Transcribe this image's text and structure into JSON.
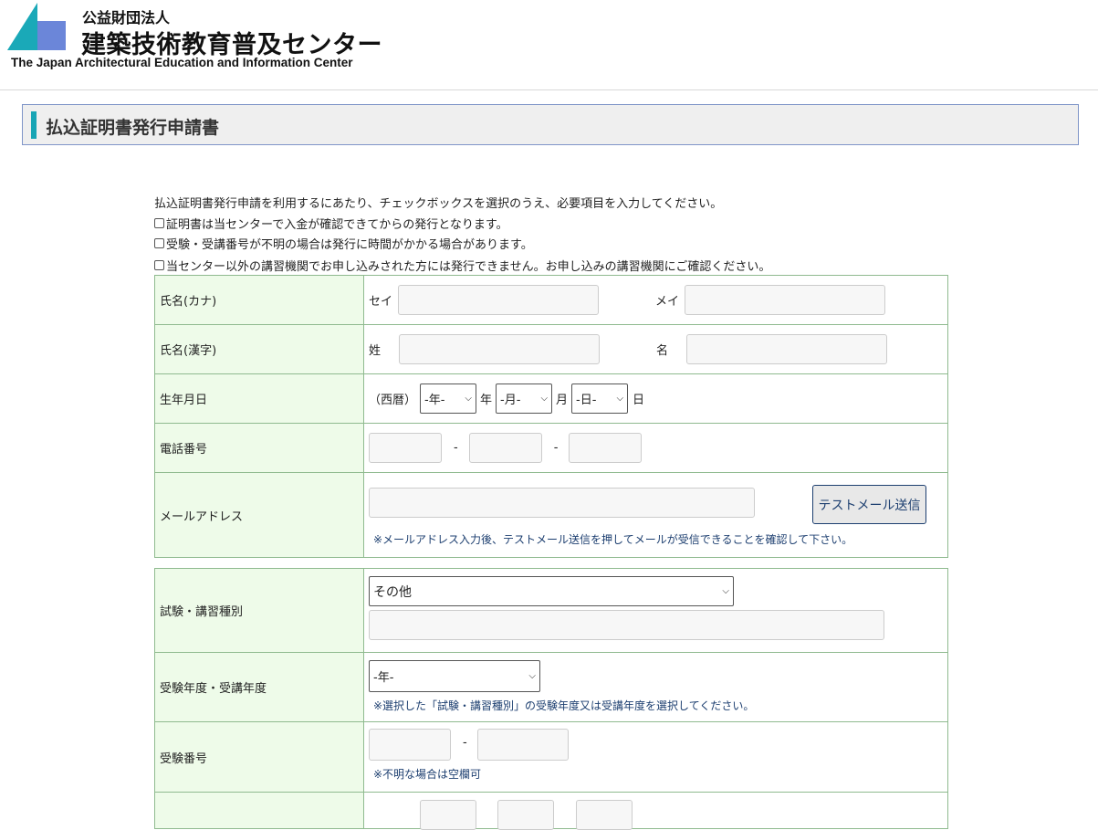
{
  "header": {
    "org_type": "公益財団法人",
    "org_name": "建築技術教育普及センター",
    "org_name_en": "The Japan Architectural Education and Information Center",
    "logo_colors": {
      "teal": "#1aa9b8",
      "blue": "#6b86d9"
    }
  },
  "page_title": "払込証明書発行申請書",
  "notices": {
    "intro": "払込証明書発行申請を利用するにあたり、チェックボックスを選択のうえ、必要項目を入力してください。",
    "items": [
      "証明書は当センターで入金が確認できてからの発行となります。",
      "受験・受講番号が不明の場合は発行に時間がかかる場合があります。",
      "当センター以外の講習機関でお申し込みされた方には発行できません。お申し込みの講習機関にご確認ください。"
    ]
  },
  "form1": {
    "name_kana": {
      "label": "氏名(カナ)",
      "sei": "セイ",
      "mei": "メイ"
    },
    "name_kanji": {
      "label": "氏名(漢字)",
      "sei": "姓",
      "mei": "名"
    },
    "birthdate": {
      "label": "生年月日",
      "era": "（西暦）",
      "year_select": "-年-",
      "year_unit": "年",
      "month_select": "-月-",
      "month_unit": "月",
      "day_select": "-日-",
      "day_unit": "日"
    },
    "phone": {
      "label": "電話番号",
      "sep": "-"
    },
    "email": {
      "label": "メールアドレス",
      "test_button": "テストメール送信",
      "note": "※メールアドレス入力後、テストメール送信を押してメールが受信できることを確認して下さい。"
    }
  },
  "form2": {
    "exam_type": {
      "label": "試験・講習種別",
      "selected": "その他"
    },
    "exam_year": {
      "label": "受験年度・受講年度",
      "selected": "-年-",
      "note": "※選択した「試験・講習種別」の受験年度又は受講年度を選択してください。"
    },
    "exam_number": {
      "label": "受験番号",
      "sep": "-",
      "note": "※不明な場合は空欄可"
    }
  },
  "colors": {
    "label_bg": "#eefbe9",
    "border": "#8fba8f",
    "note": "#1d3f70",
    "accent": "#18a5b5"
  }
}
